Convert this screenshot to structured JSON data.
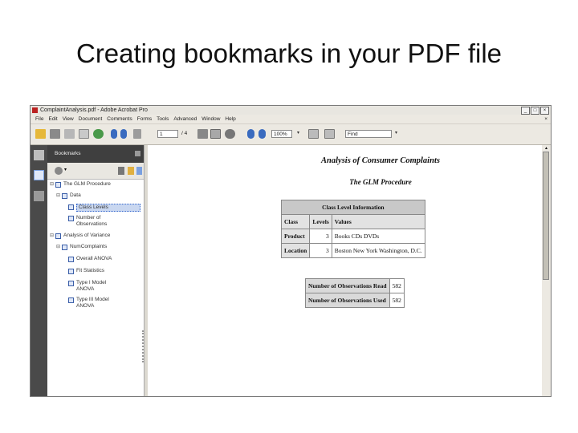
{
  "slide": {
    "title": "Creating bookmarks in your PDF file"
  },
  "window": {
    "title": "ComplaintAnalysis.pdf - Adobe Acrobat Pro",
    "controls": [
      "_",
      "□",
      "×"
    ]
  },
  "menubar": {
    "items": [
      "File",
      "Edit",
      "View",
      "Document",
      "Comments",
      "Forms",
      "Tools",
      "Advanced",
      "Window",
      "Help"
    ],
    "close": "×"
  },
  "toolbar": {
    "page_value": "1",
    "page_total": "/ 4",
    "zoom_value": "100%",
    "find_placeholder": "Find"
  },
  "bookmarks_panel": {
    "header": "Bookmarks",
    "items": [
      {
        "label": "The GLM Procedure",
        "level": 0,
        "expander": "⊟"
      },
      {
        "label": "Data",
        "level": 1,
        "expander": "⊟"
      },
      {
        "label": "Class Levels",
        "level": 2,
        "selected": true
      },
      {
        "label": "Number of\nObservations",
        "level": 2
      },
      {
        "label": "Analysis of Variance",
        "level": 0,
        "expander": "⊟"
      },
      {
        "label": "NumComplaints",
        "level": 1,
        "expander": "⊟"
      },
      {
        "label": "Overall ANOVA",
        "level": 2
      },
      {
        "label": "Fit Statistics",
        "level": 2
      },
      {
        "label": "Type I Model\nANOVA",
        "level": 2
      },
      {
        "label": "Type III Model\nANOVA",
        "level": 2
      }
    ]
  },
  "document": {
    "title": "Analysis of Consumer Complaints",
    "subtitle": "The GLM Procedure",
    "class_table": {
      "caption": "Class Level Information",
      "headers": [
        "Class",
        "Levels",
        "Values"
      ],
      "rows": [
        {
          "class": "Product",
          "levels": "3",
          "values": "Books CDs DVDs"
        },
        {
          "class": "Location",
          "levels": "3",
          "values": "Boston New York Washington, D.C."
        }
      ]
    },
    "obs_table": {
      "rows": [
        {
          "label": "Number of Observations Read",
          "value": "582"
        },
        {
          "label": "Number of Observations Used",
          "value": "582"
        }
      ]
    }
  },
  "colors": {
    "nav_dark": "#3f3f3f",
    "table_header": "#c8c8c8",
    "selection": "#c9d7f0"
  }
}
